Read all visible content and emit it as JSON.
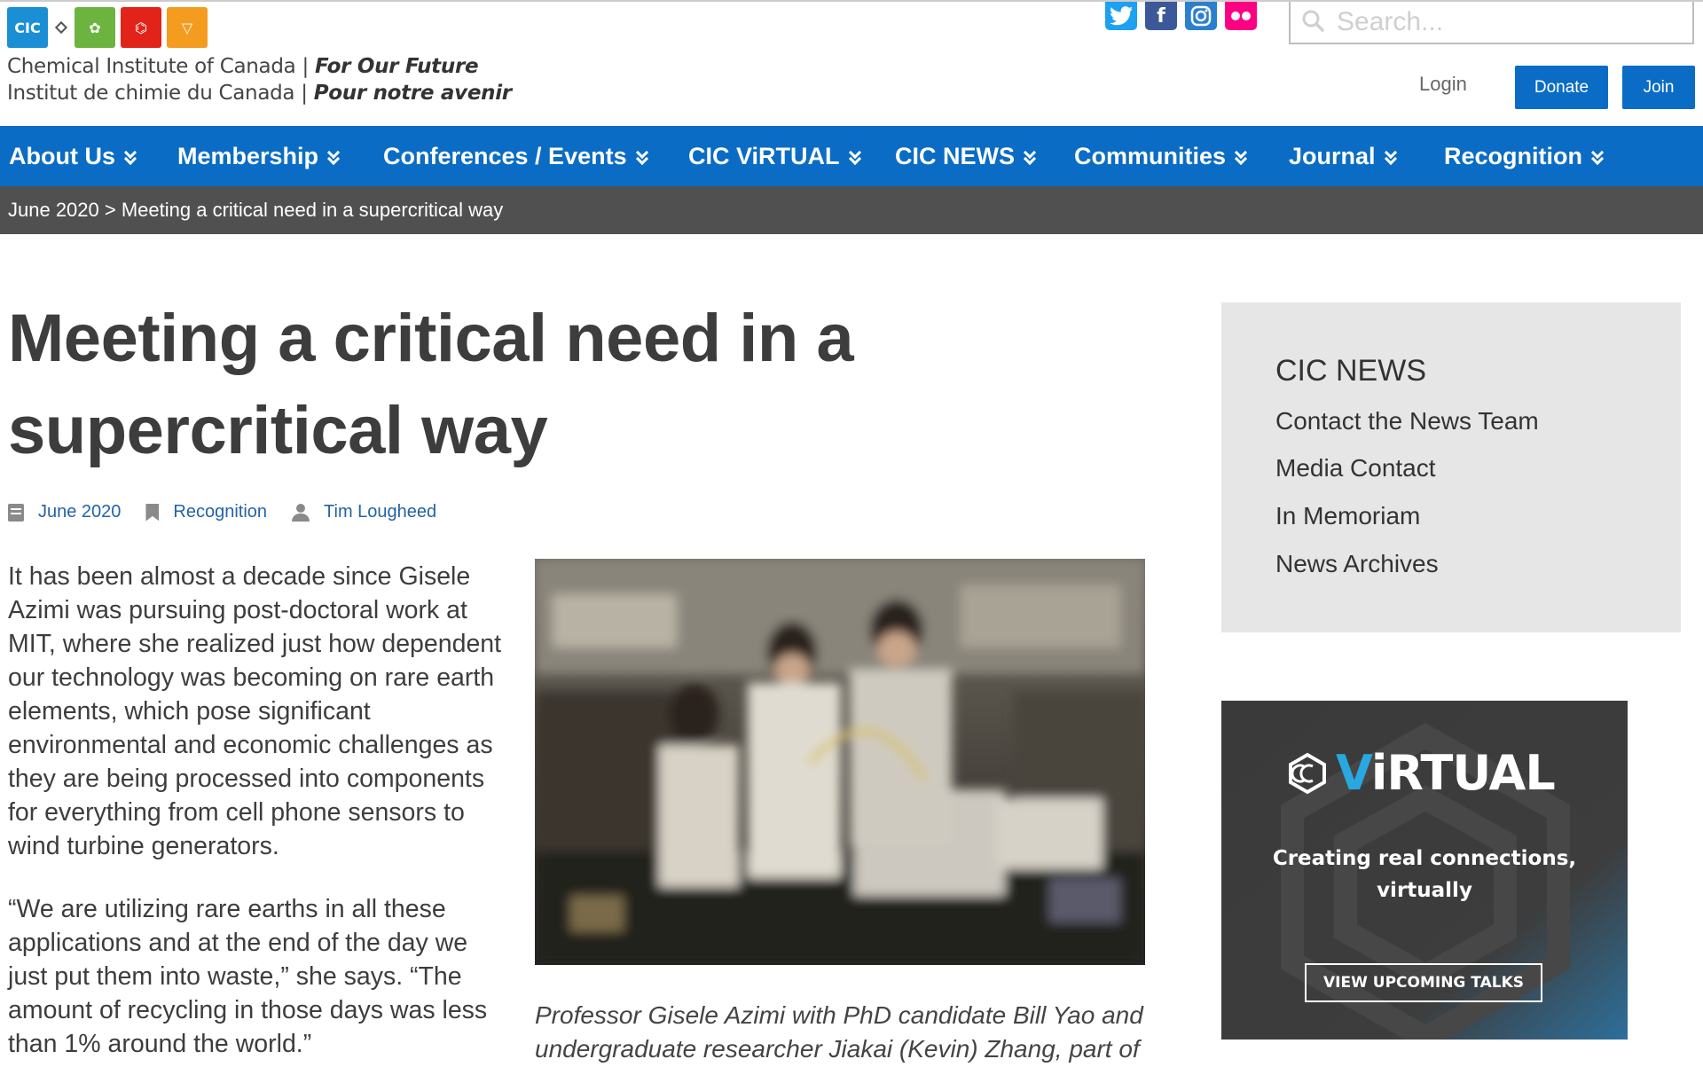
{
  "header": {
    "logo_line1_name": "Chemical Institute of Canada",
    "logo_line1_tag": "For Our Future",
    "logo_line2_name": "Institut de chimie du Canada",
    "logo_line2_tag": "Pour notre avenir",
    "logo_icons": [
      {
        "name": "cic-logo-icon",
        "color": "#1a8fd6",
        "glyph": "CIC"
      },
      {
        "name": "csc-logo-icon",
        "color": "#6db33f",
        "glyph": "✿"
      },
      {
        "name": "csche-logo-icon",
        "color": "#e2231a",
        "glyph": "⌬"
      },
      {
        "name": "csct-logo-icon",
        "color": "#f39c1f",
        "glyph": "▽"
      }
    ],
    "social": [
      {
        "name": "twitter-icon",
        "color": "#1da1f2",
        "glyph": "🐦"
      },
      {
        "name": "facebook-icon",
        "color": "#3b5998",
        "glyph": "f"
      },
      {
        "name": "instagram-icon",
        "color": "#2a7fd0",
        "glyph": "◎"
      },
      {
        "name": "flickr-icon",
        "color": "#ff0084",
        "glyph": "••"
      }
    ],
    "search_placeholder": "Search...",
    "login_label": "Login",
    "donate_label": "Donate",
    "join_label": "Join"
  },
  "nav": [
    {
      "label": "About Us"
    },
    {
      "label": "Membership"
    },
    {
      "label": "Conferences / Events"
    },
    {
      "label": "CIC ViRTUAL"
    },
    {
      "label": "CIC NEWS"
    },
    {
      "label": "Communities"
    },
    {
      "label": "Journal"
    },
    {
      "label": "Recognition"
    }
  ],
  "breadcrumb": {
    "parent": "June 2020",
    "separator": " > ",
    "current": "Meeting a critical need in a supercritical way"
  },
  "article": {
    "title": "Meeting a critical need in a supercritical way",
    "meta": {
      "date": "June 2020",
      "category": "Recognition",
      "author": "Tim Lougheed"
    },
    "paragraph1": "It has been almost a decade since Gisele Azimi was pursuing post-doctoral work at MIT, where she realized just how dependent our technology was becoming on rare earth elements, which pose significant environmental and economic challenges as they are being processed into components for everything from cell phone sensors to wind turbine generators.",
    "paragraph2": "“We are utilizing rare earths in all these applications and at the end of the day we just put them into waste,” she says. “The amount of recycling in those days was less than 1% around the world.”",
    "caption": "Professor Gisele Azimi with PhD candidate Bill Yao and undergraduate researcher Jiakai (Kevin) Zhang, part of her"
  },
  "sidebar": {
    "heading": "CIC NEWS",
    "links": [
      {
        "label": "Contact the News Team"
      },
      {
        "label": "Media Contact"
      },
      {
        "label": "In Memoriam"
      },
      {
        "label": "News Archives"
      }
    ]
  },
  "virtual_ad": {
    "brand_v": "V",
    "brand_rest": "iRTUAL",
    "tagline1": "Creating real connections,",
    "tagline2": "virtually",
    "cta": "VIEW UPCOMING TALKS",
    "accent_color": "#29a8e0"
  }
}
